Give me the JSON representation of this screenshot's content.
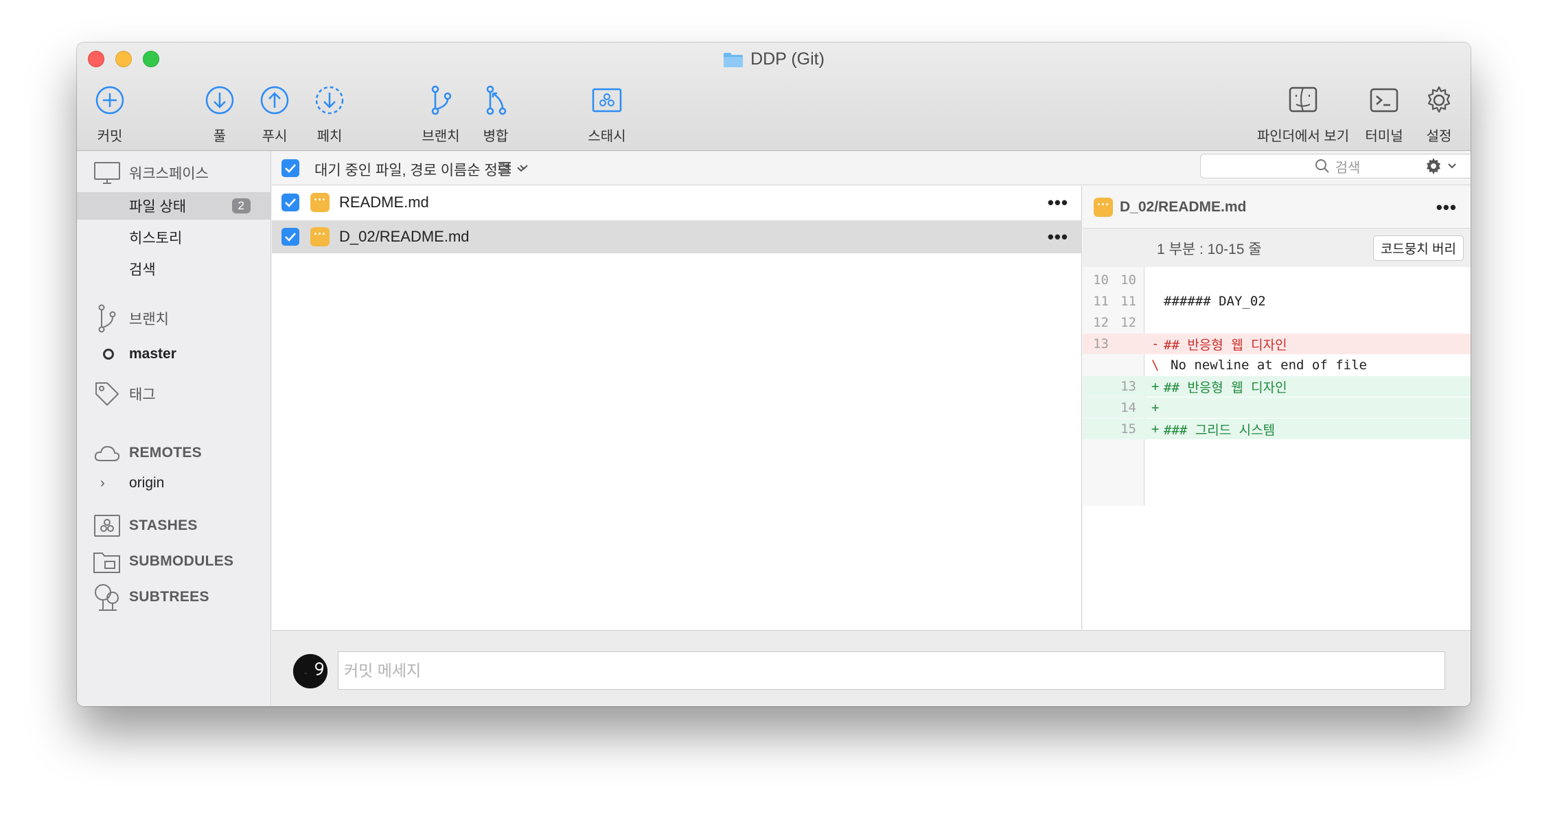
{
  "window": {
    "title": "DDP (Git)"
  },
  "toolbar": {
    "commit": "커밋",
    "pull": "풀",
    "push": "푸시",
    "fetch": "페치",
    "branch": "브랜치",
    "merge": "병합",
    "stash": "스태시",
    "finder": "파인더에서 보기",
    "terminal": "터미널",
    "settings": "설정"
  },
  "sidebar": {
    "workspace": "워크스페이스",
    "file_status": "파일 상태",
    "file_status_count": "2",
    "history": "히스토리",
    "search": "검색",
    "branches": "브랜치",
    "branch_master": "master",
    "tags": "태그",
    "remotes": "REMOTES",
    "remote_origin": "origin",
    "stashes": "STASHES",
    "submodules": "SUBMODULES",
    "subtrees": "SUBTREES"
  },
  "filebar": {
    "sort_label": "대기 중인 파일, 경로 이름순 정렬",
    "search_placeholder": "검색"
  },
  "files": [
    {
      "name": "README.md",
      "status": "modified",
      "checked": true,
      "selected": false
    },
    {
      "name": "D_02/README.md",
      "status": "modified",
      "checked": true,
      "selected": true
    }
  ],
  "diff": {
    "file": "D_02/README.md",
    "hunk_header": "1 부분 : 10-15 줄",
    "discard_label": "코드뭉치 버리",
    "lines": [
      {
        "old": "10",
        "new": "10",
        "sign": "",
        "text": "",
        "type": "ctx"
      },
      {
        "old": "11",
        "new": "11",
        "sign": "",
        "text": "###### DAY_02",
        "type": "ctx"
      },
      {
        "old": "12",
        "new": "12",
        "sign": "",
        "text": "",
        "type": "ctx"
      },
      {
        "old": "13",
        "new": "",
        "sign": "-",
        "text": "## 반응형 웹 디자인",
        "type": "del"
      },
      {
        "old": "",
        "new": "",
        "sign": "\\",
        "text": "No newline at end of file",
        "type": "note"
      },
      {
        "old": "",
        "new": "13",
        "sign": "+",
        "text": "## 반응형 웹 디자인",
        "type": "add"
      },
      {
        "old": "",
        "new": "14",
        "sign": "+",
        "text": "",
        "type": "add"
      },
      {
        "old": "",
        "new": "15",
        "sign": "+",
        "text": "### 그리드 시스템",
        "type": "add"
      }
    ]
  },
  "commit": {
    "placeholder": "커밋 메세지"
  },
  "colors": {
    "accent": "#2d8cf3",
    "modified": "#f5b840",
    "deleted": "#c9302c",
    "added": "#1e8a3a"
  }
}
